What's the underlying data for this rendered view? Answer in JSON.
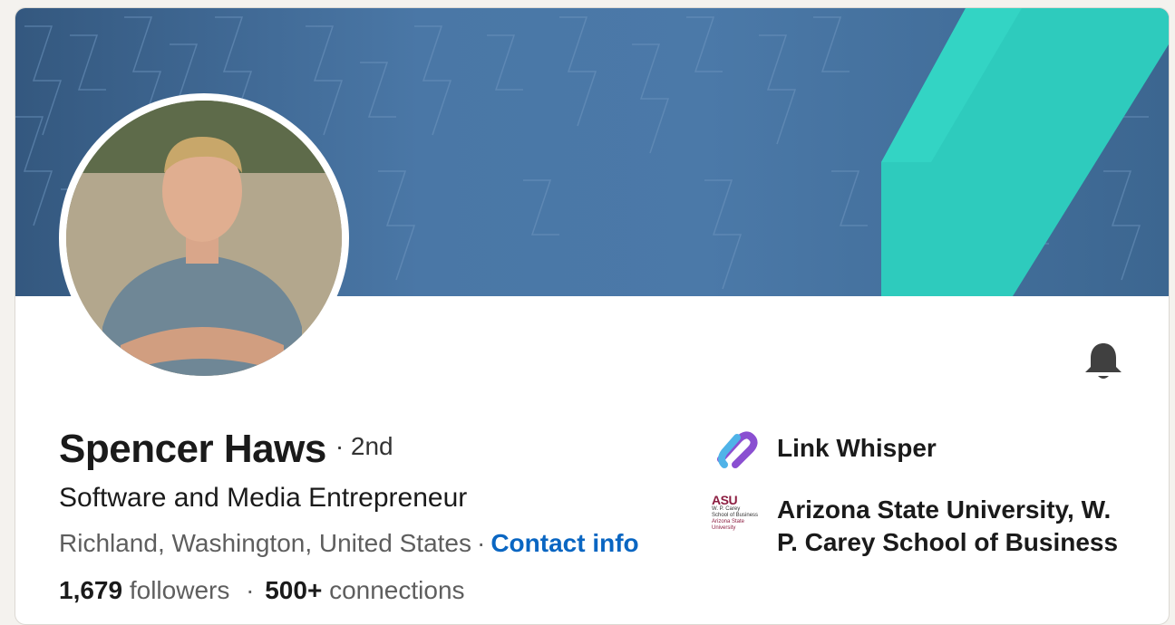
{
  "profile": {
    "name": "Spencer Haws",
    "degree": "· 2nd",
    "headline": "Software and Media Entrepreneur",
    "location": "Richland, Washington, United States",
    "location_separator": "·",
    "contact_info_label": "Contact info",
    "followers_count": "1,679",
    "followers_label": "followers",
    "stats_separator": "·",
    "connections_count": "500+",
    "connections_label": "connections"
  },
  "experience": [
    {
      "name": "Link Whisper",
      "icon": "link-whisper-logo"
    },
    {
      "name": "Arizona State University, W. P. Carey School of Business",
      "icon": "asu-wp-carey-logo"
    }
  ],
  "asu_logo_text": {
    "mark": "ASU",
    "line1": "W. P. Carey",
    "line2": "School of Business",
    "line3": "Arizona State",
    "line4": "University"
  },
  "colors": {
    "banner_blue": "#4a77a6",
    "banner_teal": "#2ecbbd",
    "link_blue": "#0a66c2",
    "asu_maroon": "#8c1d40"
  },
  "icons": {
    "notification": "bell-icon"
  }
}
